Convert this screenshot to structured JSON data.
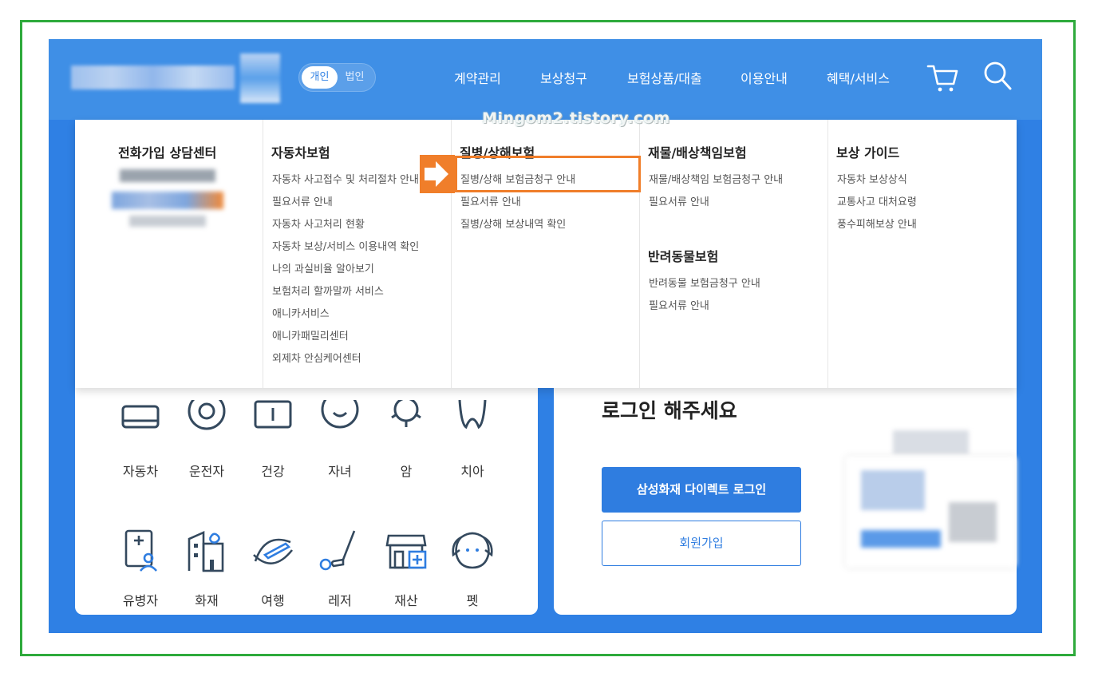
{
  "header": {
    "segment": {
      "personal": "개인",
      "corporate": "법인"
    },
    "nav": [
      {
        "label": "계약관리"
      },
      {
        "label": "보상청구"
      },
      {
        "label": "보험상품/대출"
      },
      {
        "label": "이용안내"
      },
      {
        "label": "혜택/서비스"
      }
    ],
    "icons": [
      "cart-icon",
      "search-icon"
    ]
  },
  "watermark": "Mingom2.tistory.com",
  "mega_menu": {
    "phone_center": {
      "title": "전화가입 상담센터"
    },
    "auto": {
      "title": "자동차보험",
      "items": [
        "자동차 사고접수 및 처리절차 안내",
        "필요서류 안내",
        "자동차 사고처리 현황",
        "자동차 보상/서비스 이용내역 확인",
        "나의 과실비율 알아보기",
        "보험처리 할까말까 서비스",
        "애니카서비스",
        "애니카패밀리센터",
        "외제차 안심케어센터"
      ]
    },
    "illness": {
      "title": "질병/상해보험",
      "items": [
        "질병/상해 보험금청구 안내",
        "필요서류 안내",
        "질병/상해 보상내역 확인"
      ]
    },
    "property": {
      "title": "재물/배상책임보험",
      "items": [
        "재물/배상책임 보험금청구 안내",
        "필요서류 안내"
      ]
    },
    "pet": {
      "title": "반려동물보험",
      "items": [
        "반려동물 보험금청구 안내",
        "필요서류 안내"
      ]
    },
    "guide": {
      "title": "보상 가이드",
      "items": [
        "자동차 보상상식",
        "교통사고 대처요령",
        "풍수피해보상 안내"
      ]
    }
  },
  "insurance_categories": {
    "row1": [
      "자동차",
      "운전자",
      "건강",
      "자녀",
      "암",
      "치아"
    ],
    "row2": [
      "유병자",
      "화재",
      "여행",
      "레저",
      "재산",
      "펫"
    ]
  },
  "login": {
    "title": "로그인 해주세요",
    "login_button": "삼성화재 다이렉트 로그인",
    "join_button": "회원가입"
  },
  "colors": {
    "header_blue": "#3f8fe6",
    "stage_blue": "#2f80e4",
    "button_blue": "#2f7de0",
    "highlight_orange": "#f07e2a",
    "frame_green": "#2eaa3c"
  }
}
